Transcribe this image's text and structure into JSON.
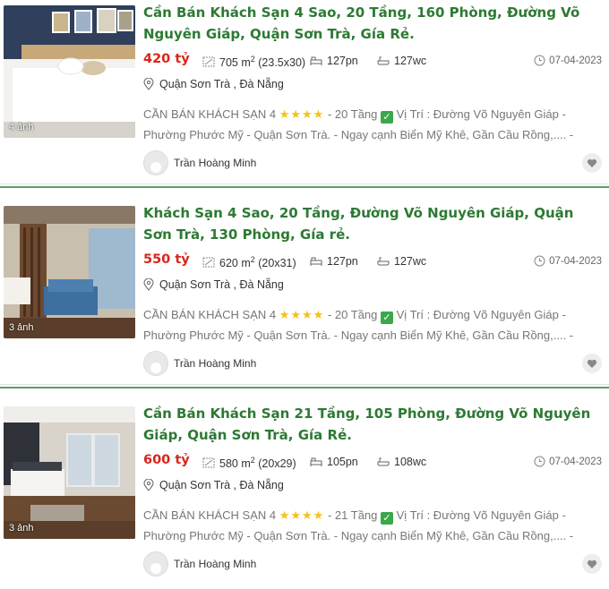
{
  "listings": [
    {
      "photo_count": "4 ảnh",
      "title": "Cần Bán Khách Sạn 4 Sao, 20 Tầng, 160 Phòng, Đường Võ Nguyên Giáp, Quận Sơn Trà, Gía Rẻ.",
      "price": "420 tỷ",
      "area": "705 m",
      "area_sup": "2",
      "dims": "(23.5x30)",
      "bedrooms": "127pn",
      "bathrooms": "127wc",
      "date": "07-04-2023",
      "location": "Quận Sơn Trà ,  Đà Nẵng",
      "desc_a": "CẦN BÁN KHÁCH SẠN 4",
      "stars": "★★★★",
      "desc_b": "- 20 Tầng",
      "desc_c": "Vị Trí : Đường Võ Nguyên Giáp - Phường Phước Mỹ - Quận Sơn Trà. - Ngay cạnh Biển Mỹ Khê, Gần Cầu Rồng,.... - N...",
      "author": "Trần Hoàng Minh"
    },
    {
      "photo_count": "3 ảnh",
      "title": "Khách Sạn 4 Sao, 20 Tầng, Đường Võ Nguyên Giáp, Quận Sơn Trà, 130 Phòng, Gía rẻ.",
      "price": "550 tỷ",
      "area": "620 m",
      "area_sup": "2",
      "dims": "(20x31)",
      "bedrooms": "127pn",
      "bathrooms": "127wc",
      "date": "07-04-2023",
      "location": "Quận Sơn Trà ,  Đà Nẵng",
      "desc_a": "CẦN BÁN KHÁCH SẠN 4",
      "stars": "★★★★",
      "desc_b": "- 20 Tầng",
      "desc_c": "Vị Trí : Đường Võ Nguyên Giáp - Phường Phước Mỹ - Quận Sơn Trà. - Ngay cạnh Biển Mỹ Khê, Gần Cầu Rồng,.... - N...",
      "author": "Trần Hoàng Minh"
    },
    {
      "photo_count": "3 ảnh",
      "title": "Cần Bán Khách Sạn 21 Tầng, 105 Phòng, Đường Võ Nguyên Giáp, Quận Sơn Trà, Gía Rẻ.",
      "price": "600 tỷ",
      "area": "580 m",
      "area_sup": "2",
      "dims": "(20x29)",
      "bedrooms": "105pn",
      "bathrooms": "108wc",
      "date": "07-04-2023",
      "location": "Quận Sơn Trà ,  Đà Nẵng",
      "desc_a": "CẦN BÁN KHÁCH SẠN 4",
      "stars": "★★★★",
      "desc_b": "- 21 Tầng",
      "desc_c": "Vị Trí : Đường Võ Nguyên Giáp - Phường Phước Mỹ - Quận Sơn Trà. - Ngay cạnh Biển Mỹ Khê, Gần Cầu Rồng,.... - N...",
      "author": "Trần Hoàng Minh"
    }
  ],
  "icons": {
    "area": "area-icon",
    "bed": "bed-icon",
    "bath": "bath-icon",
    "clock": "clock-icon",
    "location": "location-pin-icon",
    "check": "check-box-icon",
    "heart": "heart-icon"
  },
  "colors": {
    "title": "#2d7a33",
    "price": "#d9261c",
    "stars": "#f2c21a",
    "separator": "#5e9a6a"
  }
}
